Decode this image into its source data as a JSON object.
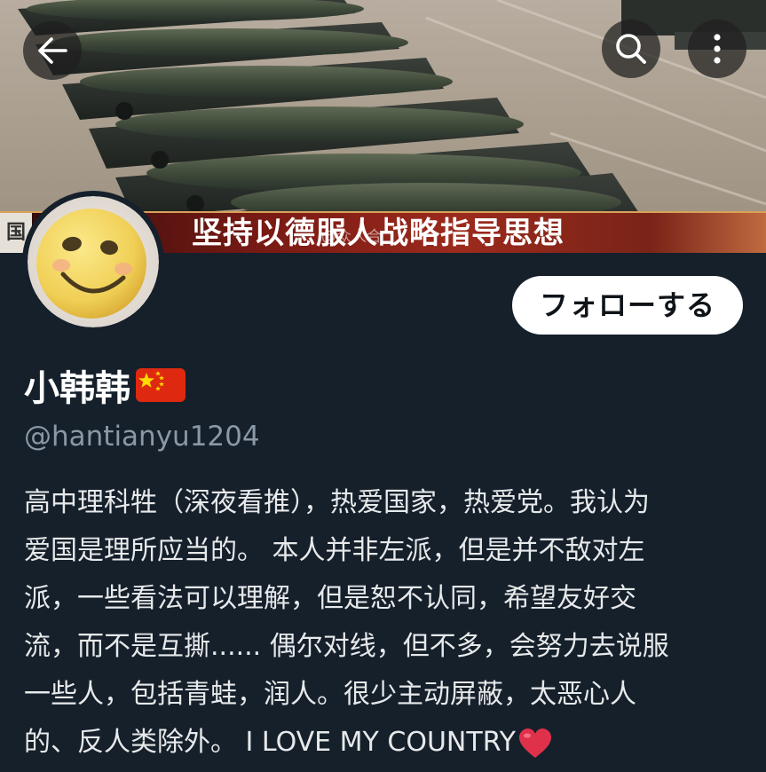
{
  "header": {
    "caption_left": "国",
    "caption": "坚持以德服人战略指导思想",
    "watermark": "@众人合"
  },
  "nav": {
    "back_icon": "arrow-left-icon",
    "search_icon": "search-icon",
    "more_icon": "more-vertical-icon"
  },
  "profile": {
    "follow_label": "フォローする",
    "display_name": "小韩韩",
    "flag": "china-flag-emoji",
    "handle": "@hantianyu1204",
    "bio_lines": [
      "高中理科牲（深夜看推），热爱国家，热爱党。我认为",
      "爱国是理所应当的。 本人并非左派，但是并不敌对左",
      "派，一些看法可以理解，但是恕不认同，希望友好交",
      "流，而不是互撕...... 偶尔对线，但不多，会努力去说服",
      "一些人，包括青蛙，润人。很少主动屏蔽，太恶心人",
      "的、反人类除外。 I LOVE MY COUNTRY"
    ],
    "bio_end_emoji": "red-heart-emoji"
  },
  "colors": {
    "background": "#15202b",
    "text": "#e7e9ea",
    "muted": "#8b98a5",
    "follow_bg": "#ffffff",
    "flag_red": "#de2910",
    "flag_star": "#ffde00"
  }
}
